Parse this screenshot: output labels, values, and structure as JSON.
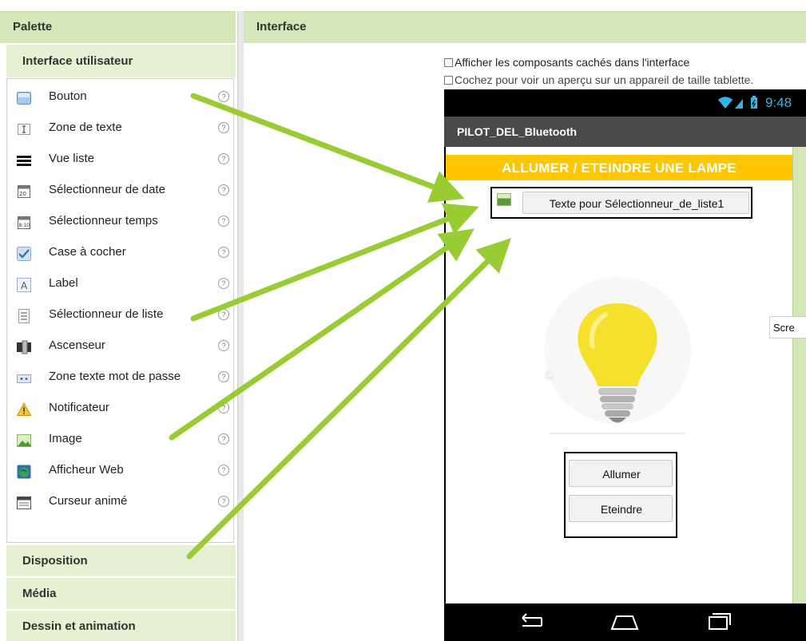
{
  "palette": {
    "title": "Palette",
    "category_open": "Interface utilisateur",
    "items": [
      {
        "label": "Bouton",
        "icon": "button-icon"
      },
      {
        "label": "Zone de texte",
        "icon": "textbox-icon"
      },
      {
        "label": "Vue liste",
        "icon": "listview-icon"
      },
      {
        "label": "Sélectionneur de date",
        "icon": "datepicker-icon"
      },
      {
        "label": "Sélectionneur temps",
        "icon": "timepicker-icon"
      },
      {
        "label": "Case à cocher",
        "icon": "checkbox-icon"
      },
      {
        "label": "Label",
        "icon": "label-icon"
      },
      {
        "label": "Sélectionneur de liste",
        "icon": "listpicker-icon"
      },
      {
        "label": "Ascenseur",
        "icon": "slider-icon"
      },
      {
        "label": "Zone texte mot de passe",
        "icon": "password-icon"
      },
      {
        "label": "Notificateur",
        "icon": "notifier-icon"
      },
      {
        "label": "Image",
        "icon": "image-icon"
      },
      {
        "label": "Afficheur Web",
        "icon": "webviewer-icon"
      },
      {
        "label": "Curseur animé",
        "icon": "spinner-icon"
      }
    ],
    "help_glyph": "?",
    "categories_closed": [
      "Disposition",
      "Média",
      "Dessin et animation"
    ]
  },
  "interface": {
    "title": "Interface",
    "show_hidden_label": "Afficher les composants cachés dans l'interface",
    "tablet_preview_label": "Cochez pour voir un aperçu sur un appareil de taille tablette.",
    "screen_tooltip": "Scre"
  },
  "phone": {
    "status_time": "9:48",
    "app_title": "PILOT_DEL_Bluetooth",
    "banner": "ALLUMER / ETEINDRE UNE LAMPE",
    "listpicker_text": "Texte pour Sélectionneur_de_liste1",
    "btn_on": "Allumer",
    "btn_off": "Eteindre"
  },
  "colors": {
    "header_green": "#d5e6b9",
    "category_green": "#e6f0d2",
    "banner_yellow": "#fec600",
    "arrow_green": "#99cc33",
    "status_blue": "#33b5e5"
  }
}
